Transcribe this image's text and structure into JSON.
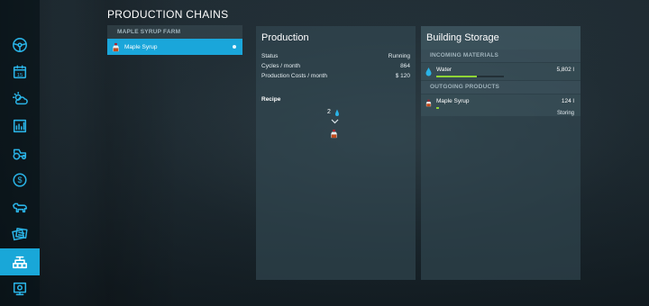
{
  "page": {
    "title": "PRODUCTION CHAINS"
  },
  "colors": {
    "accent": "#1aa6da",
    "fill_bar": "#8fd436"
  },
  "sidebar": {
    "items": [
      {
        "icon": "steering-wheel-icon"
      },
      {
        "icon": "calendar-icon",
        "label": "15"
      },
      {
        "icon": "weather-icon"
      },
      {
        "icon": "prices-chart-icon"
      },
      {
        "icon": "tractor-icon"
      },
      {
        "icon": "finances-icon",
        "label": "$"
      },
      {
        "icon": "animals-icon"
      },
      {
        "icon": "contracts-icon"
      },
      {
        "icon": "production-chains-icon",
        "active": true
      },
      {
        "icon": "tour-icon"
      }
    ]
  },
  "chains": {
    "farm": "MAPLE SYRUP FARM",
    "items": [
      {
        "label": "Maple Syrup",
        "icon": "maple-syrup-icon",
        "selected": true
      }
    ]
  },
  "production": {
    "title": "Production",
    "rows": [
      {
        "label": "Status",
        "value": "Running"
      },
      {
        "label": "Cycles / month",
        "value": "864"
      },
      {
        "label": "Production Costs / month",
        "value": "$ 120"
      }
    ],
    "recipe": {
      "label": "Recipe",
      "input_amount": "2",
      "input_icon": "water-icon",
      "output_icon": "maple-syrup-icon"
    }
  },
  "storage": {
    "title": "Building Storage",
    "incoming": {
      "label": "INCOMING MATERIALS",
      "items": [
        {
          "name": "Water",
          "amount": "5,802 l",
          "fill": 0.6,
          "icon": "water-icon"
        }
      ]
    },
    "outgoing": {
      "label": "OUTGOING PRODUCTS",
      "items": [
        {
          "name": "Maple Syrup",
          "amount": "124 l",
          "fill": 0.04,
          "mode": "Storing",
          "icon": "maple-syrup-icon"
        }
      ]
    }
  }
}
